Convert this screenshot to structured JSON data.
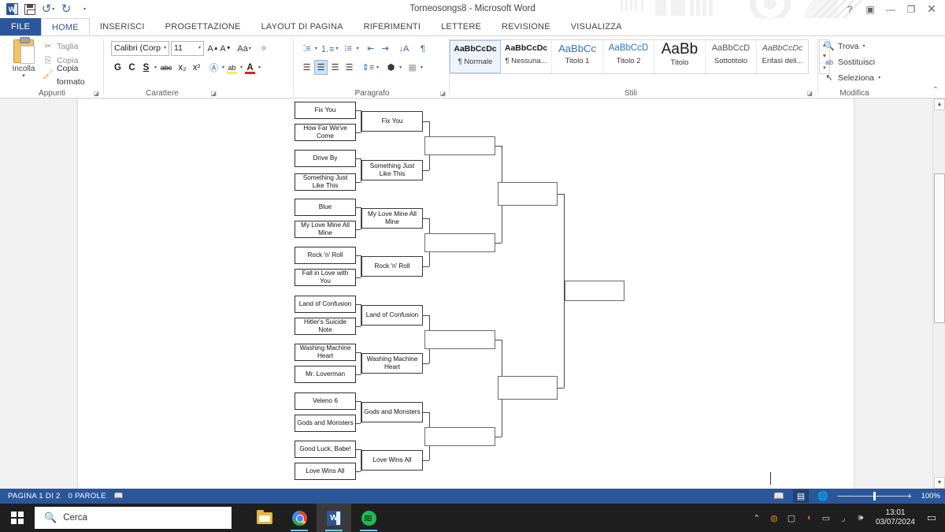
{
  "window": {
    "title": "Torneosongs8 - Microsoft Word",
    "quick_access": [
      {
        "name": "word-app-icon",
        "glyph": "W"
      },
      {
        "name": "save-icon",
        "glyph": ""
      },
      {
        "name": "undo-icon",
        "glyph": "↺"
      },
      {
        "name": "redo-icon",
        "glyph": "↻"
      },
      {
        "name": "customize-qat-icon",
        "glyph": "⌄"
      }
    ],
    "controls": {
      "help": "?",
      "ribbon_display": "▣",
      "minimize": "—",
      "restore": "❐",
      "close": "✕",
      "account": "👤"
    }
  },
  "ribbon": {
    "tabs": [
      {
        "label": "FILE",
        "kind": "file"
      },
      {
        "label": "HOME",
        "kind": "active"
      },
      {
        "label": "INSERISCI",
        "kind": "normal"
      },
      {
        "label": "PROGETTAZIONE",
        "kind": "normal"
      },
      {
        "label": "LAYOUT DI PAGINA",
        "kind": "normal"
      },
      {
        "label": "RIFERIMENTI",
        "kind": "normal"
      },
      {
        "label": "LETTERE",
        "kind": "normal"
      },
      {
        "label": "REVISIONE",
        "kind": "normal"
      },
      {
        "label": "VISUALIZZA",
        "kind": "normal"
      }
    ],
    "groups": {
      "clipboard": {
        "label": "Appunti",
        "paste": "Incolla",
        "items": [
          {
            "label": "Taglia",
            "icon": "scissors-icon",
            "glyph": "✂"
          },
          {
            "label": "Copia",
            "icon": "copy-icon",
            "glyph": "⎘"
          },
          {
            "label": "Copia formato",
            "icon": "format-painter-icon",
            "glyph": "🖌"
          }
        ]
      },
      "font": {
        "label": "Carattere",
        "font_name": "Calibri (Corp",
        "font_size": "11",
        "buttons": [
          {
            "name": "grow-font-icon",
            "glyph": "A⌃"
          },
          {
            "name": "shrink-font-icon",
            "glyph": "A⌄"
          },
          {
            "name": "change-case-icon",
            "glyph": "Aa"
          },
          {
            "name": "clear-formatting-icon",
            "glyph": "✦"
          },
          {
            "name": "bold-icon",
            "glyph": "G"
          },
          {
            "name": "italic-icon",
            "glyph": "C"
          },
          {
            "name": "underline-icon",
            "glyph": "S"
          },
          {
            "name": "strikethrough-icon",
            "glyph": "abc"
          },
          {
            "name": "subscript-icon",
            "glyph": "x₂"
          },
          {
            "name": "superscript-icon",
            "glyph": "x²"
          },
          {
            "name": "text-effects-icon",
            "glyph": "Ⓐ"
          },
          {
            "name": "highlight-color-icon",
            "glyph": "ab"
          },
          {
            "name": "font-color-icon",
            "glyph": "A"
          }
        ]
      },
      "paragraph": {
        "label": "Paragrafo",
        "buttons": [
          {
            "name": "bullets-icon",
            "glyph": "☰"
          },
          {
            "name": "numbering-icon",
            "glyph": "⒈"
          },
          {
            "name": "multilevel-list-icon",
            "glyph": "⋮≡"
          },
          {
            "name": "decrease-indent-icon",
            "glyph": "⇤"
          },
          {
            "name": "increase-indent-icon",
            "glyph": "⇥"
          },
          {
            "name": "sort-icon",
            "glyph": "A↓"
          },
          {
            "name": "show-marks-icon",
            "glyph": "¶"
          },
          {
            "name": "align-left-icon",
            "glyph": "≡"
          },
          {
            "name": "align-center-icon",
            "glyph": "≡"
          },
          {
            "name": "align-right-icon",
            "glyph": "≡"
          },
          {
            "name": "justify-icon",
            "glyph": "≡"
          },
          {
            "name": "line-spacing-icon",
            "glyph": "⇕"
          },
          {
            "name": "shading-icon",
            "glyph": "◇"
          },
          {
            "name": "borders-icon",
            "glyph": "▦"
          }
        ]
      },
      "styles": {
        "label": "Stili",
        "gallery": [
          {
            "preview": "AaBbCcDc",
            "name": "¶ Normale",
            "selected": true
          },
          {
            "preview": "AaBbCcDc",
            "name": "¶ Nessuna...",
            "selected": false
          },
          {
            "preview": "AaBbCc",
            "name": "Titolo 1",
            "selected": false
          },
          {
            "preview": "AaBbCcD",
            "name": "Titolo 2",
            "selected": false
          },
          {
            "preview": "AaBb",
            "name": "Titolo",
            "selected": false
          },
          {
            "preview": "AaBbCcD",
            "name": "Sottotitolo",
            "selected": false
          },
          {
            "preview": "AaBbCcDc",
            "name": "Enfasi deli...",
            "selected": false
          }
        ]
      },
      "editing": {
        "label": "Modifica",
        "items": [
          {
            "label": "Trova",
            "icon": "binoculars-icon",
            "glyph": "🔍"
          },
          {
            "label": "Sostituisci",
            "icon": "replace-icon",
            "glyph": "ab"
          },
          {
            "label": "Seleziona",
            "icon": "select-icon",
            "glyph": "↖"
          }
        ]
      }
    },
    "collapse": "⌃"
  },
  "document": {
    "bracket": {
      "round1": [
        "Fix You",
        "How Far We've Come",
        "Drive By",
        "Something Just Like This",
        "Blue",
        "My Love Mine All Mine",
        "Rock 'n' Roll",
        "Fall in Love with You",
        "Land of Confusion",
        "Hitler's Suicide Note",
        "Washing Machine Heart",
        "Mr. Loverman",
        "Veleno 6",
        "Gods and Monsters",
        "Good Luck, Babe!",
        "Love Wins All"
      ],
      "round2": [
        "Fix You",
        "Something Just Like This",
        "My Love Mine All Mine",
        "Rock 'n' Roll",
        "Land of Confusion",
        "Washing Machine Heart",
        "Gods and Monsters",
        "Love Wins All"
      ],
      "round3": [
        "",
        "",
        "",
        ""
      ],
      "round4": [
        "",
        ""
      ],
      "round5": [
        ""
      ]
    }
  },
  "status_bar": {
    "page": "PAGINA 1 DI 2",
    "words": "0 PAROLE",
    "proofing_icon": "proofing-errors-icon",
    "views": [
      {
        "name": "read-mode-icon",
        "glyph": "▤",
        "selected": false
      },
      {
        "name": "print-layout-icon",
        "glyph": "▤",
        "selected": true
      },
      {
        "name": "web-layout-icon",
        "glyph": "▤",
        "selected": false
      }
    ],
    "zoom_out": "−",
    "zoom_in": "+",
    "zoom_level": "100%"
  },
  "taskbar": {
    "search_placeholder": "Cerca",
    "apps": [
      {
        "name": "file-explorer",
        "state": "idle"
      },
      {
        "name": "google-chrome",
        "state": "running"
      },
      {
        "name": "microsoft-word",
        "state": "active"
      },
      {
        "name": "spotify",
        "state": "running"
      }
    ],
    "tray": [
      {
        "name": "show-hidden-icons-icon",
        "glyph": "⌃"
      },
      {
        "name": "nvidia-icon",
        "glyph": "◍"
      },
      {
        "name": "camera-icon",
        "glyph": "▢"
      },
      {
        "name": "onedrive-sync-icon",
        "glyph": "◖"
      },
      {
        "name": "battery-icon",
        "glyph": "▭"
      },
      {
        "name": "wifi-icon",
        "glyph": "◣"
      },
      {
        "name": "volume-icon",
        "glyph": "🕪"
      }
    ],
    "clock_time": "13:01",
    "clock_date": "03/07/2024",
    "notification_icon": "notification-center-icon"
  }
}
